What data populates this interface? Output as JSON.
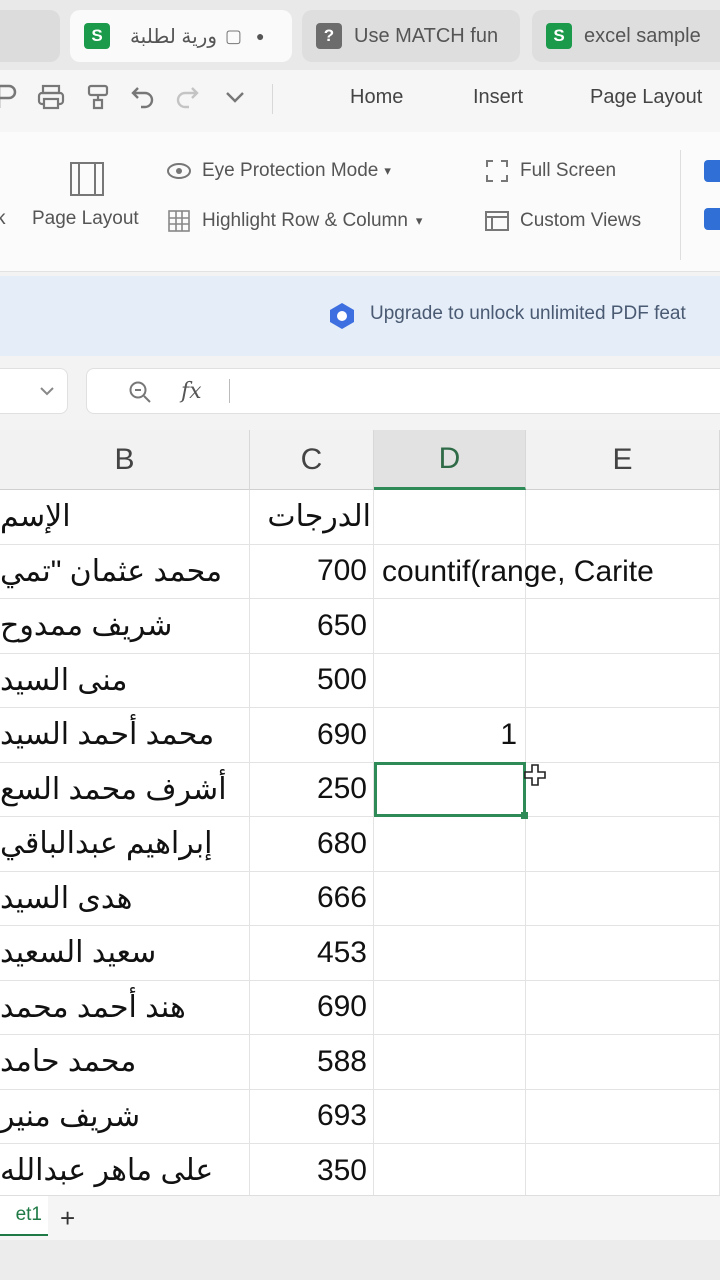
{
  "tabs": [
    {
      "label": "ورية لطلبة",
      "icon": "sheet-icon",
      "active": true
    },
    {
      "label": "Use MATCH fun",
      "icon": "help-icon",
      "active": false
    },
    {
      "label": "excel sample",
      "icon": "sheet-icon",
      "active": false
    }
  ],
  "menu": {
    "home": "Home",
    "insert": "Insert",
    "page_layout": "Page Layout"
  },
  "ribbon": {
    "page_layout": "Page Layout",
    "partial_left": "k",
    "eye_protection": "Eye Protection Mode",
    "highlight": "Highlight Row & Column",
    "full_screen": "Full Screen",
    "custom_views": "Custom Views"
  },
  "banner": {
    "text": "Upgrade to unlock unlimited PDF feat"
  },
  "formula_bar": {
    "fx": "fx",
    "value": ""
  },
  "columns": [
    "B",
    "C",
    "D",
    "E"
  ],
  "header_row": {
    "name": "الإسم",
    "score": "الدرجات"
  },
  "rows": [
    {
      "name": "محمد عثمان \"تمي",
      "score": "700",
      "d": ""
    },
    {
      "name": "شريف ممدوح",
      "score": "650",
      "d": ""
    },
    {
      "name": "منى السيد",
      "score": "500",
      "d": ""
    },
    {
      "name": "محمد أحمد السيد",
      "score": "690",
      "d": "1"
    },
    {
      "name": "أشرف محمد السع",
      "score": "250",
      "d": ""
    },
    {
      "name": "إبراهيم عبدالباقي",
      "score": "680",
      "d": ""
    },
    {
      "name": "هدى السيد",
      "score": "666",
      "d": ""
    },
    {
      "name": "سعيد السعيد",
      "score": "453",
      "d": ""
    },
    {
      "name": "هند أحمد محمد",
      "score": "690",
      "d": ""
    },
    {
      "name": "محمد حامد",
      "score": "588",
      "d": ""
    },
    {
      "name": "شريف منير",
      "score": "693",
      "d": ""
    },
    {
      "name": "على ماهر عبدالله",
      "score": "350",
      "d": ""
    }
  ],
  "overflow_formula": "countif(range, Carite",
  "sheet_tab": "et1",
  "add_sheet": "+",
  "colors": {
    "accent_green": "#2e8b57",
    "banner_bg": "#e4edf8",
    "checkbox_blue": "#2f6fd6"
  }
}
